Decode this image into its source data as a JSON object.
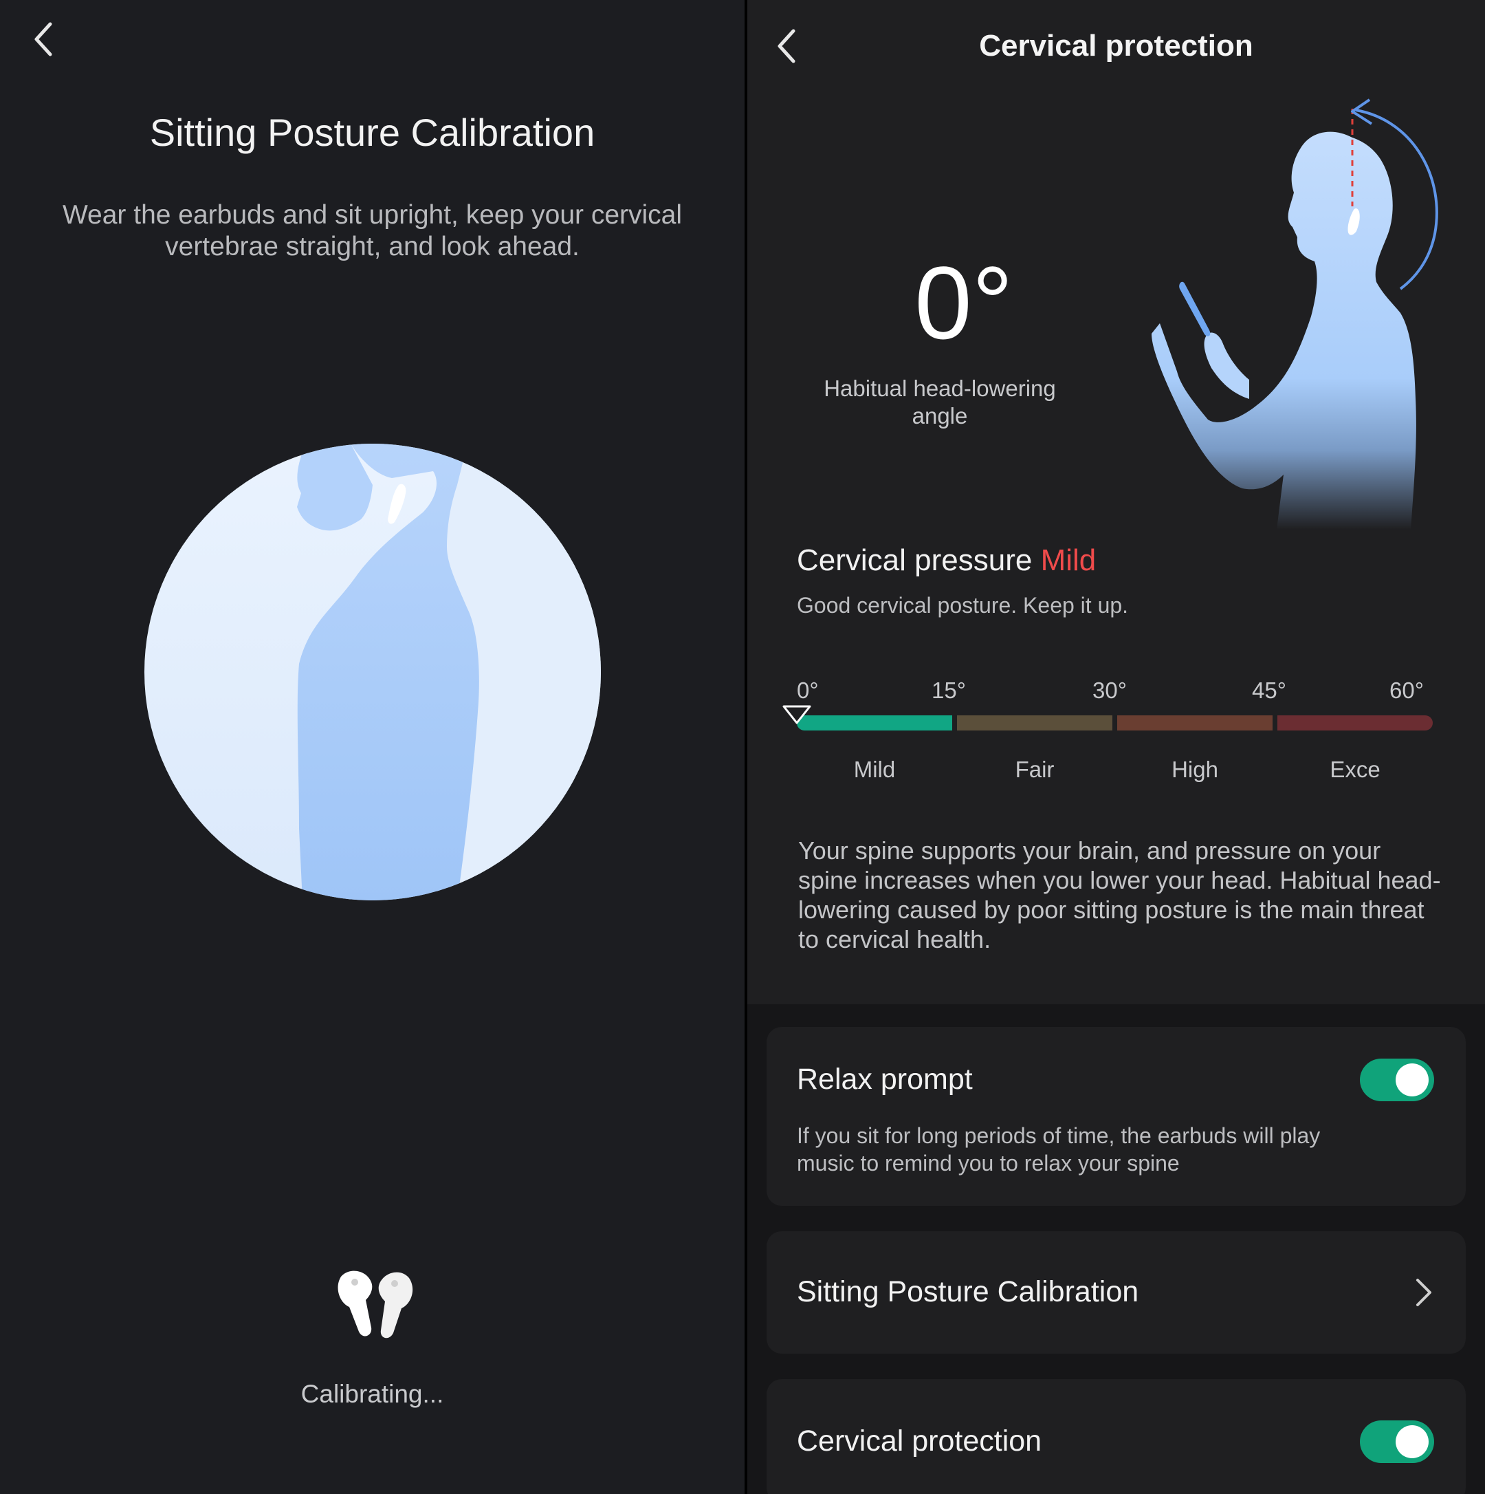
{
  "left_screen": {
    "title": "Sitting Posture Calibration",
    "description": "Wear the earbuds and sit upright, keep your cervical vertebrae straight, and look ahead.",
    "status": "Calibrating..."
  },
  "right_screen": {
    "header_title": "Cervical protection",
    "angle_value": "0°",
    "angle_label": "Habitual head-lowering angle",
    "pressure": {
      "label": "Cervical pressure",
      "level": "Mild",
      "message": "Good cervical posture. Keep it up."
    },
    "scale": {
      "ticks": [
        "0°",
        "15°",
        "30°",
        "45°",
        "60°"
      ],
      "segments": [
        {
          "label": "Mild",
          "color": "#11a684"
        },
        {
          "label": "Fair",
          "color": "#5b4f3a"
        },
        {
          "label": "High",
          "color": "#6a3e31"
        },
        {
          "label": "Exce",
          "color": "#6b2d32"
        }
      ],
      "current_angle": 0
    },
    "info_text": "Your spine supports your brain, and pressure on your spine increases when you lower your head. Habitual head-lowering caused by poor sitting posture is the main threat to cervical health.",
    "settings": {
      "relax_prompt": {
        "title": "Relax prompt",
        "description": "If you sit for long periods of time, the earbuds will play music to remind you to relax your spine",
        "enabled": true
      },
      "calibration": {
        "title": "Sitting Posture Calibration"
      },
      "cervical_protection": {
        "title": "Cervical protection",
        "enabled": true
      }
    }
  },
  "colors": {
    "accent_green": "#10a37a",
    "warning_red": "#f04b4b",
    "illustration_blue": "#a9cdfa"
  }
}
